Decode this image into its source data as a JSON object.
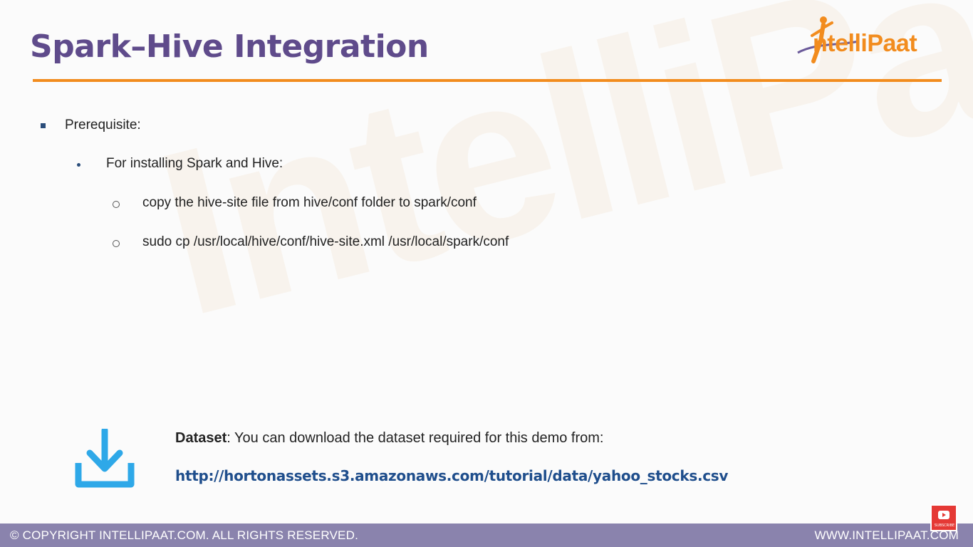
{
  "slide": {
    "title": "Spark–Hive Integration",
    "logo_text": "ntelliPaat",
    "watermark_text": "IntelliPaat",
    "bullets": {
      "level1": "Prerequisite:",
      "level2": "For installing Spark and Hive:",
      "level3": [
        "copy the hive-site file from hive/conf folder to spark/conf",
        "sudo cp /usr/local/hive/conf/hive-site.xml /usr/local/spark/conf"
      ]
    },
    "dataset": {
      "label": "Dataset",
      "text": ": You can download the dataset required for this demo from:",
      "url": "http://hortonassets.s3.amazonaws.com/tutorial/data/yahoo_stocks.csv"
    },
    "footer": {
      "left": "© COPYRIGHT  INTELLIPAAT.COM. ALL RIGHTS RESERVED.",
      "right": "WWW.INTELLIPAAT.COM"
    },
    "subscribe_label": "SUBSCRIBE"
  },
  "colors": {
    "title": "#5f4b8b",
    "accent_orange": "#f28c1e",
    "footer_bg": "#8a83ad",
    "link": "#1f4e8c",
    "icon_blue": "#2ea8e8",
    "subscribe_red": "#e53935"
  },
  "icons": [
    "intellipaat-logo-icon",
    "download-icon",
    "youtube-subscribe-icon"
  ]
}
